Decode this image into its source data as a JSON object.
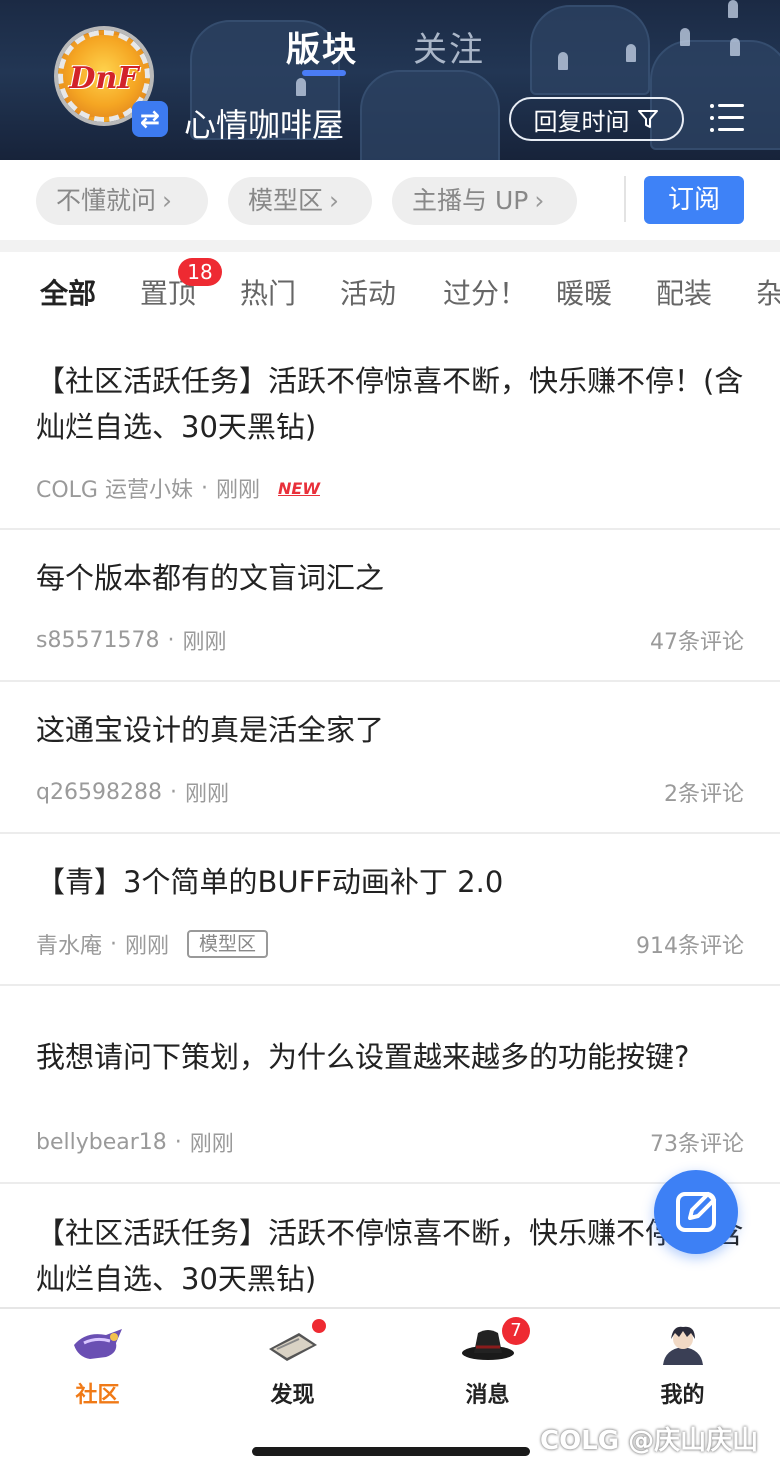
{
  "header": {
    "logo_text": "DnF",
    "tabs": [
      {
        "label": "版块",
        "active": true
      },
      {
        "label": "关注",
        "active": false
      }
    ],
    "forum_name": "心情咖啡屋",
    "sort_label": "回复时间",
    "accent_color": "#3e82f7"
  },
  "subforums": {
    "chips": [
      {
        "label": "不懂就问",
        "arrow": "›"
      },
      {
        "label": "模型区",
        "arrow": "›"
      },
      {
        "label": "主播与 UP",
        "arrow": "›"
      }
    ],
    "subscribe_label": "订阅"
  },
  "categories": {
    "items": [
      "全部",
      "置顶",
      "热门",
      "活动",
      "过分！",
      "暖暖",
      "配装",
      "杂"
    ],
    "active_index": 0,
    "pinned_badge": "18"
  },
  "posts": [
    {
      "title": "【社区活跃任务】活跃不停惊喜不断，快乐赚不停！(含灿烂自选、30天黑钻)",
      "author": "COLG 运营小妹",
      "time": "刚刚",
      "tag": "NEW",
      "comments": ""
    },
    {
      "title": "每个版本都有的文盲词汇之",
      "author": "s85571578",
      "time": "刚刚",
      "tag": "",
      "comments": "47条评论"
    },
    {
      "title": "这通宝设计的真是活全家了",
      "author": "q26598288",
      "time": "刚刚",
      "tag": "",
      "comments": "2条评论"
    },
    {
      "title": "【青】3个简单的BUFF动画补丁 2.0",
      "author": "青水庵",
      "time": "刚刚",
      "tag": "模型区",
      "comments": "914条评论"
    },
    {
      "title": "我想请问下策划，为什么设置越来越多的功能按键?",
      "author": "bellybear18",
      "time": "刚刚",
      "tag": "",
      "comments": "73条评论"
    },
    {
      "title": "【社区活跃任务】活跃不停惊喜不断，快乐赚不停！(含灿烂自选、30天黑钻)",
      "author": "",
      "time": "",
      "tag": "",
      "comments": ""
    }
  ],
  "meta_separator": "·",
  "bottom_nav": {
    "items": [
      {
        "label": "社区",
        "icon": "community-icon",
        "active": true
      },
      {
        "label": "发现",
        "icon": "discover-icon",
        "active": false
      },
      {
        "label": "消息",
        "icon": "message-icon",
        "active": false,
        "badge": "7"
      },
      {
        "label": "我的",
        "icon": "profile-avatar-icon",
        "active": false
      }
    ],
    "active_color": "#f07a17"
  },
  "watermark": "COLG @庆山庆山"
}
